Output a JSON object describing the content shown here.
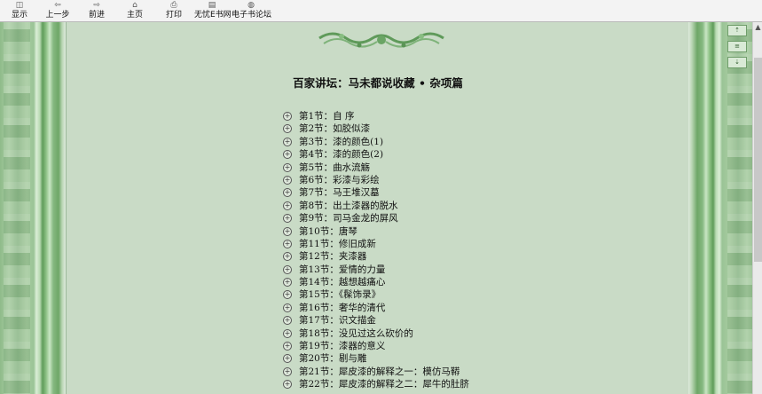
{
  "toolbar": {
    "buttons": [
      {
        "label": "显示",
        "icon": "show-hide-icon"
      },
      {
        "label": "上一步",
        "icon": "back-arrow-icon"
      },
      {
        "label": "前进",
        "icon": "forward-arrow-icon"
      },
      {
        "label": "主页",
        "icon": "home-icon"
      },
      {
        "label": "打印",
        "icon": "printer-icon"
      },
      {
        "label": "无忧E书网",
        "icon": "document-icon"
      },
      {
        "label": "电子书论坛",
        "icon": "globe-icon"
      }
    ]
  },
  "book": {
    "title": "百家讲坛：马未都说收藏 • 杂项篇",
    "chapters": [
      "第1节：自 序",
      "第2节：如胶似漆",
      "第3节：漆的颜色(1)",
      "第4节：漆的颜色(2)",
      "第5节：曲水流觞",
      "第6节：彩漆与彩绘",
      "第7节：马王堆汉墓",
      "第8节：出土漆器的脱水",
      "第9节：司马金龙的屏风",
      "第10节：唐琴",
      "第11节：修旧成新",
      "第12节：夹漆器",
      "第13节：爱情的力量",
      "第14节：越想越痛心",
      "第15节：《髹饰录》",
      "第16节：奢华的清代",
      "第17节：识文描金",
      "第18节：没见过这么砍价的",
      "第19节：漆器的意义",
      "第20节：剔与雕",
      "第21节：犀皮漆的解释之一：模仿马鞯",
      "第22节：犀皮漆的解释之二：犀牛的肚脐"
    ]
  },
  "colors": {
    "page_bg": "#c9dbc6",
    "side_green": "#8fbb8a"
  }
}
